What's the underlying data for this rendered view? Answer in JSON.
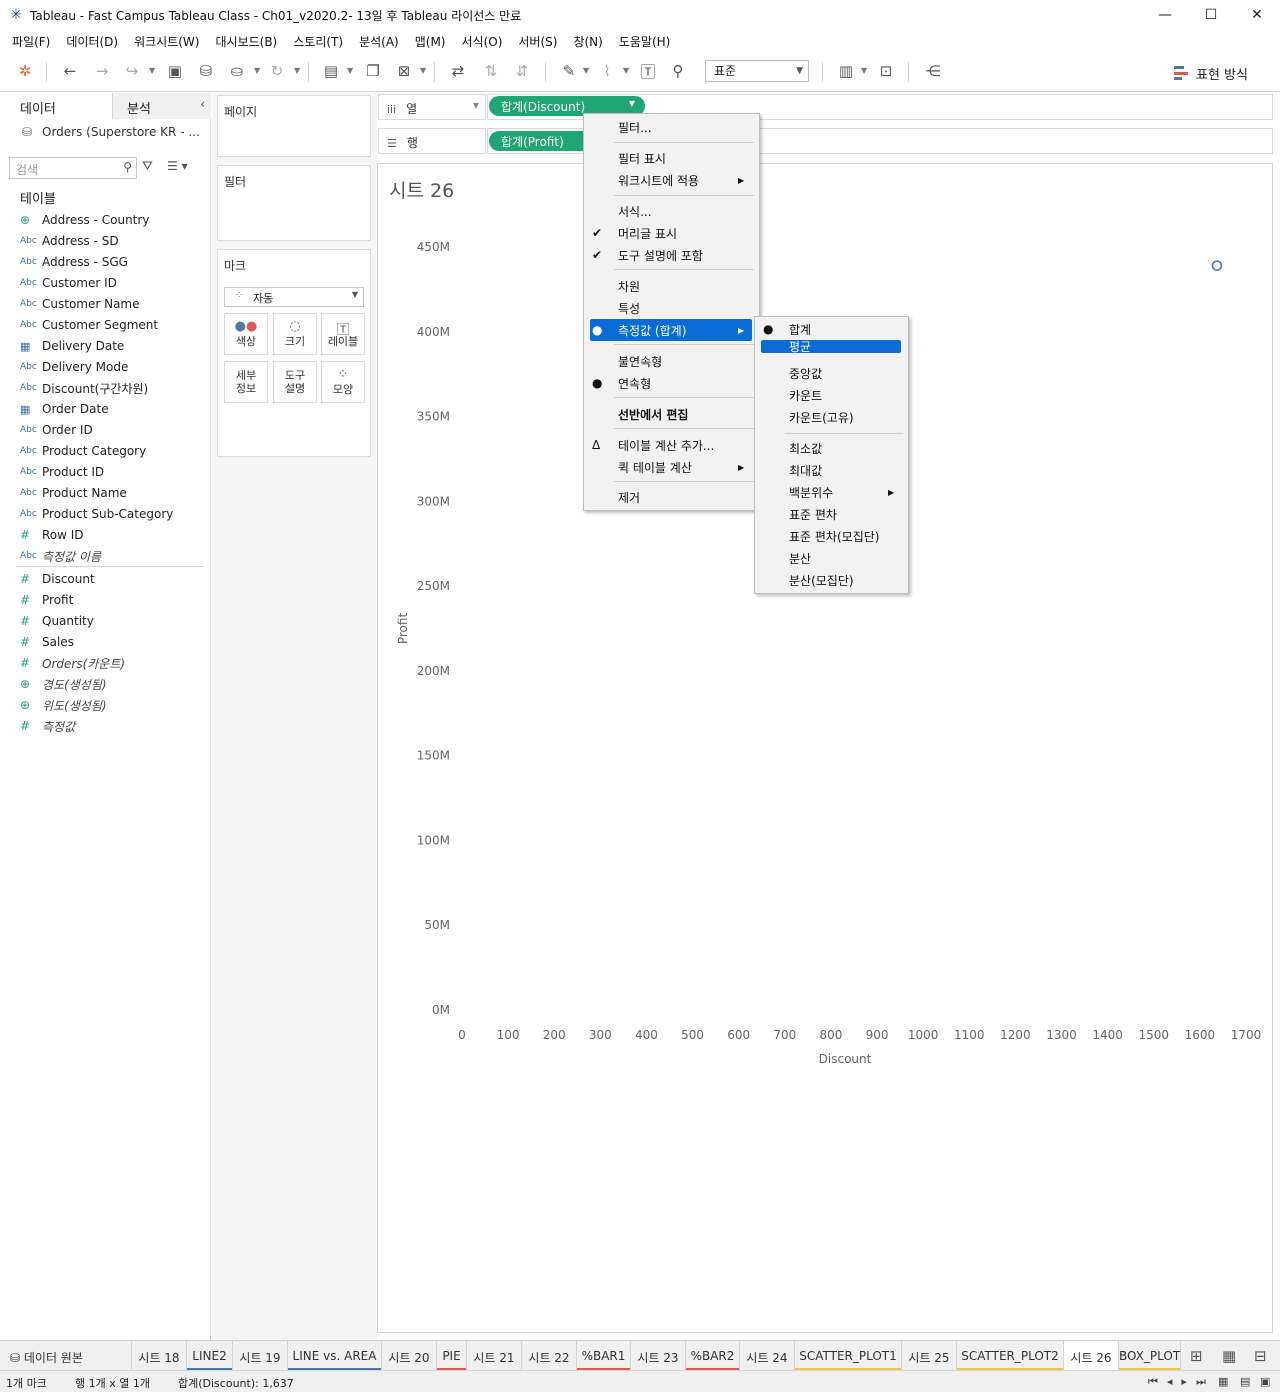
{
  "window": {
    "title": "Tableau - Fast Campus Tableau Class - Ch01_v2020.2- 13일 후 Tableau 라이선스 만료",
    "minimize": "—",
    "maximize": "☐",
    "close": "✕"
  },
  "menubar": [
    "파일(F)",
    "데이터(D)",
    "워크시트(W)",
    "대시보드(B)",
    "스토리(T)",
    "분석(A)",
    "맵(M)",
    "서식(O)",
    "서버(S)",
    "창(N)",
    "도움말(H)"
  ],
  "toolbar": {
    "fit_select": "표준",
    "show_me": "표현 방식",
    "icons": [
      "tableau-logo-icon",
      "undo-icon",
      "redo-icon",
      "replay-icon",
      "save-icon",
      "new-datasource-icon",
      "pause-updates-icon",
      "refresh-icon",
      "new-worksheet-icon",
      "duplicate-icon",
      "clear-icon",
      "swap-icon",
      "sort-asc-icon",
      "sort-desc-icon",
      "highlight-icon",
      "group-icon",
      "label-icon",
      "pin-icon",
      "cards-icon",
      "presentation-icon",
      "share-icon"
    ]
  },
  "data_pane": {
    "tab_data": "데이터",
    "tab_analysis": "분석",
    "datasource": "Orders (Superstore KR - ...",
    "search_placeholder": "검색",
    "tables_heading": "테이블",
    "dimensions": [
      {
        "type": "geo",
        "label": "Address - Country"
      },
      {
        "type": "abc",
        "label": "Address - SD"
      },
      {
        "type": "abc",
        "label": "Address - SGG"
      },
      {
        "type": "abc",
        "label": "Customer ID"
      },
      {
        "type": "abc",
        "label": "Customer Name"
      },
      {
        "type": "abc",
        "label": "Customer Segment"
      },
      {
        "type": "date",
        "label": "Delivery Date"
      },
      {
        "type": "abc",
        "label": "Delivery Mode"
      },
      {
        "type": "abc",
        "label": "Discount(구간차원)"
      },
      {
        "type": "date",
        "label": "Order Date"
      },
      {
        "type": "abc",
        "label": "Order ID"
      },
      {
        "type": "abc",
        "label": "Product Category"
      },
      {
        "type": "abc",
        "label": "Product ID"
      },
      {
        "type": "abc",
        "label": "Product Name"
      },
      {
        "type": "abc",
        "label": "Product Sub-Category"
      },
      {
        "type": "num",
        "label": "Row ID"
      },
      {
        "type": "abc",
        "label": "측정값 이름",
        "italic": true
      }
    ],
    "measures": [
      {
        "type": "num",
        "label": "Discount"
      },
      {
        "type": "num",
        "label": "Profit"
      },
      {
        "type": "num",
        "label": "Quantity"
      },
      {
        "type": "num",
        "label": "Sales"
      },
      {
        "type": "num",
        "label": "Orders(카운트)",
        "italic": true
      },
      {
        "type": "geo",
        "label": "경도(생성됨)",
        "italic": true
      },
      {
        "type": "geo",
        "label": "위도(생성됨)",
        "italic": true
      },
      {
        "type": "num",
        "label": "측정값",
        "italic": true
      }
    ]
  },
  "cards": {
    "pages": "페이지",
    "filters": "필터",
    "marks": "마크",
    "marks_type": "자동",
    "buttons": [
      {
        "name": "color",
        "label": "색상"
      },
      {
        "name": "size",
        "label": "크기"
      },
      {
        "name": "label",
        "label": "레이블"
      },
      {
        "name": "detail",
        "label": "세부\n정보"
      },
      {
        "name": "tooltip",
        "label": "도구\n설명"
      },
      {
        "name": "shape",
        "label": "모양"
      }
    ]
  },
  "shelves": {
    "columns_label": "열",
    "rows_label": "행",
    "columns_pill": "합계(Discount)",
    "rows_pill": "합계(Profit)"
  },
  "sheet": {
    "title": "시트 26"
  },
  "chart_data": {
    "type": "scatter",
    "title": "시트 26",
    "xlabel": "Discount",
    "ylabel": "Profit",
    "xlim": [
      0,
      1700
    ],
    "ylim": [
      0,
      450
    ],
    "x_ticks": [
      0,
      100,
      200,
      300,
      400,
      500,
      600,
      700,
      800,
      900,
      1000,
      1100,
      1200,
      1300,
      1400,
      1500,
      1600,
      1700
    ],
    "y_ticks": [
      "0M",
      "50M",
      "100M",
      "150M",
      "200M",
      "250M",
      "300M",
      "350M",
      "400M",
      "450M"
    ],
    "y_tick_values": [
      0,
      50,
      100,
      150,
      200,
      250,
      300,
      350,
      400,
      450
    ],
    "grid": false,
    "points": [
      {
        "x": 1637,
        "y": 439
      }
    ],
    "point_color": "#4e79a7"
  },
  "context_menu": {
    "items": [
      "필터...",
      "필터 표시",
      "워크시트에 적용",
      "서식...",
      "머리글 표시",
      "도구 설명에 포함",
      "차원",
      "특성",
      "측정값 (합계)",
      "불연속형",
      "연속형",
      "선반에서 편집",
      "테이블 계산 추가...",
      "퀵 테이블 계산",
      "제거"
    ]
  },
  "submenu": {
    "items": [
      "합계",
      "평균",
      "중앙값",
      "카운트",
      "카운트(고유)",
      "최소값",
      "최대값",
      "백분위수",
      "표준 편차",
      "표준 편차(모집단)",
      "분산",
      "분산(모집단)"
    ]
  },
  "sheet_tabs": [
    {
      "label": "데이터 원본",
      "color": ""
    },
    {
      "label": "시트 18",
      "color": ""
    },
    {
      "label": "LINE2",
      "color": "#4e79a7"
    },
    {
      "label": "시트 19",
      "color": ""
    },
    {
      "label": "LINE vs. AREA",
      "color": "#4e79a7"
    },
    {
      "label": "시트 20",
      "color": ""
    },
    {
      "label": "PIE",
      "color": "#e15759"
    },
    {
      "label": "시트 21",
      "color": ""
    },
    {
      "label": "시트 22",
      "color": ""
    },
    {
      "label": "%BAR1",
      "color": "#e15759"
    },
    {
      "label": "시트 23",
      "color": ""
    },
    {
      "label": "%BAR2",
      "color": "#e15759"
    },
    {
      "label": "시트 24",
      "color": ""
    },
    {
      "label": "SCATTER_PLOT1",
      "color": "#edc948"
    },
    {
      "label": "시트 25",
      "color": ""
    },
    {
      "label": "SCATTER_PLOT2",
      "color": "#edc948"
    },
    {
      "label": "시트 26",
      "color": ""
    },
    {
      "label": "BOX_PLOT",
      "color": "#edc948"
    }
  ],
  "status": {
    "marks": "1개 마크",
    "rows_cols": "행 1개 x 열 1개",
    "sum": "합계(Discount): 1,637"
  }
}
